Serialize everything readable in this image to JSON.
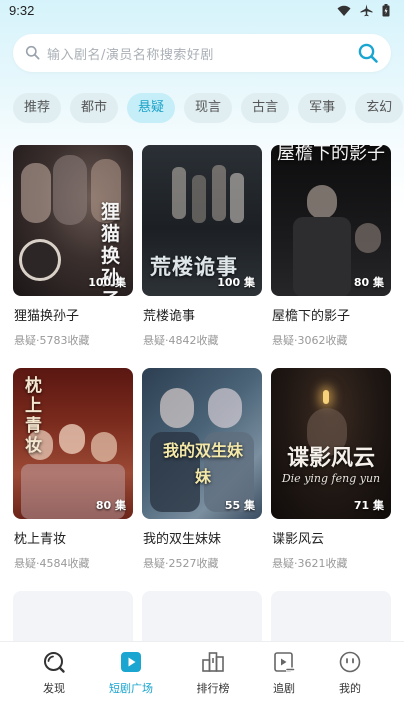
{
  "status_bar": {
    "time": "9:32",
    "icons": [
      "wifi-icon",
      "airplane-icon",
      "battery-icon"
    ]
  },
  "search": {
    "placeholder": "输入剧名/演员名称搜索好剧"
  },
  "tabs": [
    {
      "label": "推荐",
      "active": false
    },
    {
      "label": "都市",
      "active": false
    },
    {
      "label": "悬疑",
      "active": true
    },
    {
      "label": "现言",
      "active": false
    },
    {
      "label": "古言",
      "active": false
    },
    {
      "label": "军事",
      "active": false
    },
    {
      "label": "玄幻",
      "active": false
    }
  ],
  "dramas": [
    {
      "title": "狸猫换孙子",
      "meta": "悬疑·5783收藏",
      "episodes": "100 集",
      "poster_text": "狸猫换孙子"
    },
    {
      "title": "荒楼诡事",
      "meta": "悬疑·4842收藏",
      "episodes": "100 集",
      "poster_text": "荒楼诡事"
    },
    {
      "title": "屋檐下的影子",
      "meta": "悬疑·3062收藏",
      "episodes": "80 集",
      "poster_text": "屋檐下的影子"
    },
    {
      "title": "枕上青妆",
      "meta": "悬疑·4584收藏",
      "episodes": "80 集",
      "poster_text": "枕上青妆"
    },
    {
      "title": "我的双生妹妹",
      "meta": "悬疑·2527收藏",
      "episodes": "55 集",
      "poster_text": "我的双生妹妹"
    },
    {
      "title": "谍影风云",
      "meta": "悬疑·3621收藏",
      "episodes": "71 集",
      "poster_text": "谍影风云",
      "poster_subtext": "Die ying feng yun"
    }
  ],
  "nav": [
    {
      "label": "发现",
      "icon": "discover-icon",
      "active": false
    },
    {
      "label": "短剧广场",
      "icon": "play-square-icon",
      "active": true
    },
    {
      "label": "排行榜",
      "icon": "ranking-icon",
      "active": false
    },
    {
      "label": "追剧",
      "icon": "follow-drama-icon",
      "active": false
    },
    {
      "label": "我的",
      "icon": "profile-icon",
      "active": false
    }
  ],
  "colors": {
    "accent": "#19a4cf",
    "active_tab_bg": "#c6eef8",
    "tab_bg": "#e0eef2"
  }
}
